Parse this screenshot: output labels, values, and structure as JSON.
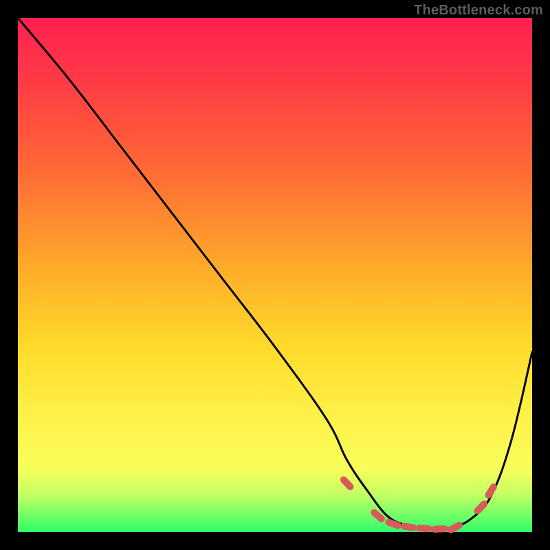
{
  "watermark": "TheBottleneck.com",
  "chart_data": {
    "type": "line",
    "title": "",
    "xlabel": "",
    "ylabel": "",
    "xlim": [
      0,
      100
    ],
    "ylim": [
      0,
      100
    ],
    "grid": false,
    "series": [
      {
        "name": "bottleneck-curve",
        "x": [
          0,
          10,
          20,
          30,
          40,
          50,
          60,
          64,
          68,
          72,
          76,
          80,
          84,
          88,
          92,
          96,
          100
        ],
        "y": [
          100,
          88,
          75,
          62,
          49,
          36,
          22,
          14,
          8,
          3,
          1.2,
          0.5,
          0.8,
          2.5,
          7,
          18,
          35
        ]
      }
    ],
    "scatter": {
      "name": "highlighted-points",
      "style": "dash",
      "color": "#d85a5a",
      "points": [
        {
          "x": 64,
          "y": 9.5
        },
        {
          "x": 70,
          "y": 3.2
        },
        {
          "x": 73,
          "y": 1.6
        },
        {
          "x": 76,
          "y": 1.0
        },
        {
          "x": 79,
          "y": 0.7
        },
        {
          "x": 82,
          "y": 0.6
        },
        {
          "x": 85,
          "y": 0.9
        },
        {
          "x": 90,
          "y": 4.8
        },
        {
          "x": 92,
          "y": 8.0
        }
      ]
    },
    "background_gradient": {
      "orientation": "vertical",
      "stops": [
        {
          "pos": 0.0,
          "color": "#ff2050"
        },
        {
          "pos": 0.3,
          "color": "#ff6a34"
        },
        {
          "pos": 0.64,
          "color": "#ffdb2a"
        },
        {
          "pos": 0.88,
          "color": "#f6ff5a"
        },
        {
          "pos": 1.0,
          "color": "#2dff6a"
        }
      ]
    }
  }
}
